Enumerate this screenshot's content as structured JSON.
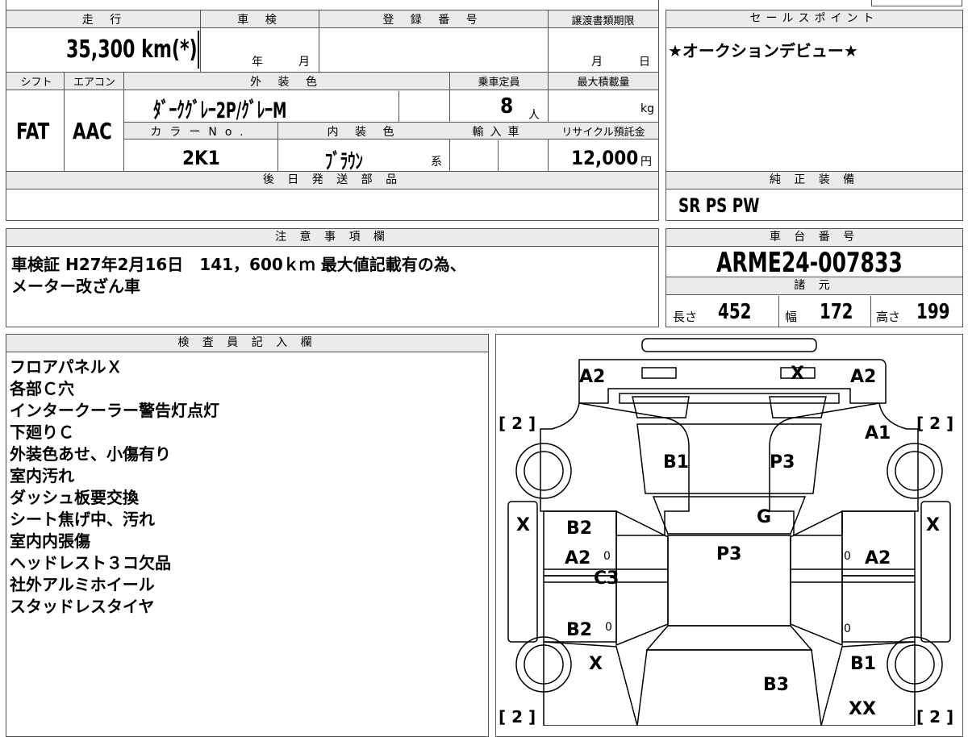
{
  "spec_sheet": {
    "mileage_label": "走 行",
    "mileage_value": "35,300 km(*)",
    "inspection_label": "車 検",
    "inspection_year_unit": "年",
    "inspection_month_unit": "月",
    "registration_label": "登 録 番 号",
    "transfer_label": "譲渡書類期限",
    "transfer_month_unit": "月",
    "transfer_day_unit": "日",
    "shift_label": "シフト",
    "shift_value": "FAT",
    "aircon_label": "エアコン",
    "aircon_value": "AAC",
    "exterior_color_label": "外 装 色",
    "exterior_color_value": "ﾀﾞｰｸｸﾞﾚｰ2P/ｸﾞﾚｰM",
    "capacity_label": "乗車定員",
    "capacity_value": "8",
    "capacity_unit": "人",
    "max_load_label": "最大積載量",
    "max_load_unit": "kg",
    "color_no_label": "カラーNo.",
    "color_no_value": "2K1",
    "interior_color_label": "内 装 色",
    "interior_color_value": "ﾌﾞﾗｳﾝ",
    "interior_color_suffix": "系",
    "import_label": "輸入車",
    "recycle_label": "リサイクル預託金",
    "recycle_value": "12,000",
    "recycle_unit": "円",
    "later_parts_label": "後 日 発 送 部 品"
  },
  "sales_point": {
    "header": "セールスポイント",
    "text": "★オークションデビュー★"
  },
  "genuine_equipment": {
    "header": "純 正 装 備",
    "text": "SR PS PW"
  },
  "notes": {
    "header": "注 意 事 項 欄",
    "line1": "車検証 H27年2月16日　141，600ｋｍ 最大値記載有の為、",
    "line2": "メーター改ざん車"
  },
  "chassis": {
    "header": "車 台 番 号",
    "value": "ARME24-007833",
    "spec_header": "諸 元",
    "length_label": "長さ",
    "length_value": "452",
    "width_label": "幅",
    "width_value": "172",
    "height_label": "高さ",
    "height_value": "199"
  },
  "inspector": {
    "header": "検 査 員 記 入 欄",
    "lines": [
      "フロアパネルＸ",
      "各部Ｃ穴",
      "インタークーラー警告灯点灯",
      "下廻りＣ",
      "外装色あせ、小傷有り",
      "室内汚れ",
      "ダッシュ板要交換",
      "シート焦げ中、汚れ",
      "室内内張傷",
      "ヘッドレスト３コ欠品",
      "社外アルミホイール",
      "スタッドレスタイヤ"
    ]
  },
  "diagram_marks": {
    "rear_left": "A2",
    "rear_center": "X",
    "rear_right": "A2",
    "tire_rear_left": "[ 2 ]",
    "tire_rear_right": "[ 2 ]",
    "quarter_right": "A1",
    "roof_rear_left": "B1",
    "roof_rear_right": "P3",
    "side_left": "X",
    "side_right": "X",
    "door_rear_left": "B2",
    "glass": "G",
    "roof": "P3",
    "door_left_mid": "A2",
    "door_left_mid_zero": "0",
    "door_right_mid_zero": "0",
    "door_right_mid": "A2",
    "sill_left": "C3",
    "door_front_left": "B2",
    "door_front_left_zero": "0",
    "door_front_right_zero": "0",
    "front_left": "X",
    "front_right": "B1",
    "bonnet": "B3",
    "front_bumper_right": "XX",
    "tire_front_left": "[ 2 ]",
    "tire_front_right": "[ 2 ]"
  }
}
